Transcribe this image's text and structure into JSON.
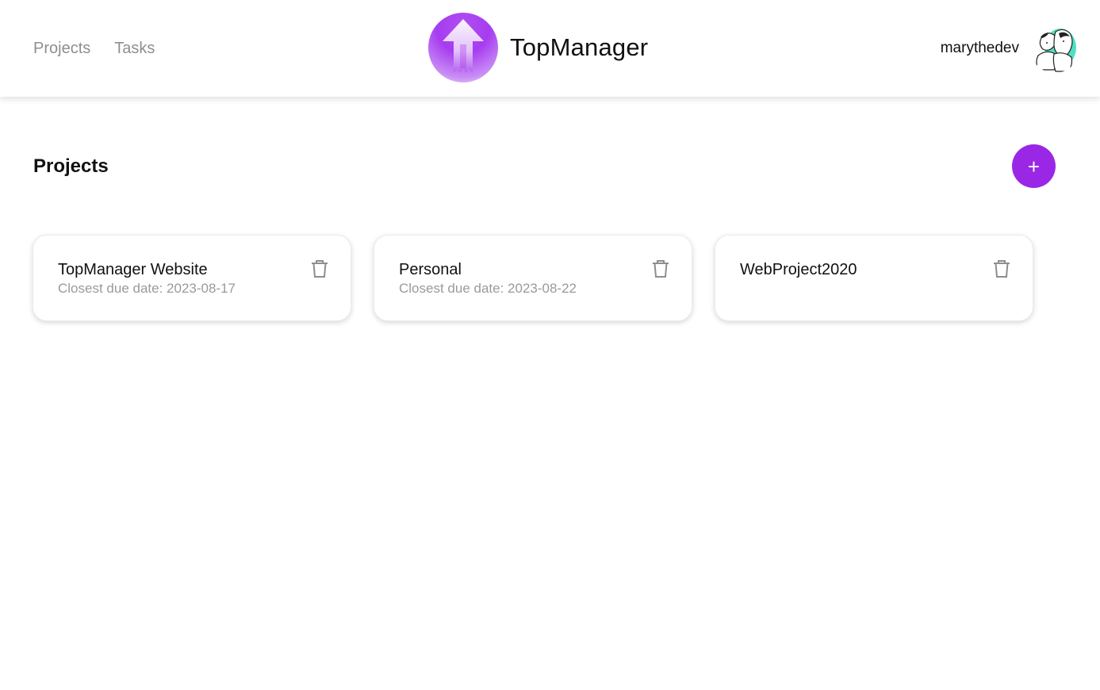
{
  "header": {
    "nav": [
      {
        "label": "Projects"
      },
      {
        "label": "Tasks"
      }
    ],
    "app_title": "TopManager",
    "username": "marythedev",
    "logo_icon": "arrow-up-icon",
    "avatar_icon": "avatar-illustration"
  },
  "main": {
    "title": "Projects",
    "add_label": "+",
    "projects": [
      {
        "name": "TopManager Website",
        "due": "Closest due date: 2023-08-17"
      },
      {
        "name": "Personal",
        "due": "Closest due date: 2023-08-22"
      },
      {
        "name": "WebProject2020",
        "due": ""
      }
    ]
  },
  "colors": {
    "accent": "#9b27e6",
    "muted_text": "#8e8e8e"
  }
}
